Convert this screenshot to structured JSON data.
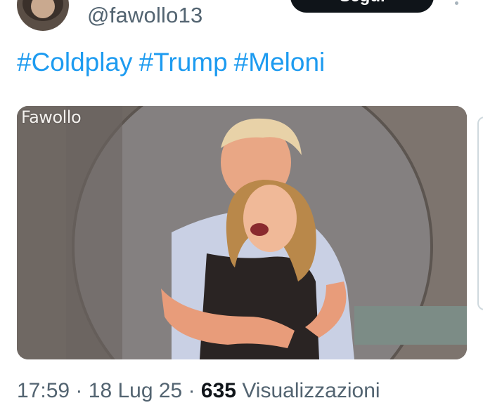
{
  "author": {
    "handle": "@fawollo13",
    "avatar_icon": "user-avatar",
    "follow_label": "Segui"
  },
  "tweet": {
    "hashtags": [
      "#Coldplay",
      "#Trump",
      "#Meloni"
    ],
    "media": {
      "watermark": "Fawollo"
    },
    "time": "17:59",
    "date": "18 Lug 25",
    "separator": "·",
    "views_count": "635",
    "views_label": "Visualizzazioni"
  },
  "colors": {
    "link": "#1d9bf0",
    "secondary_text": "#536471",
    "primary_text": "#0f1419",
    "button_bg": "#0f1419"
  }
}
